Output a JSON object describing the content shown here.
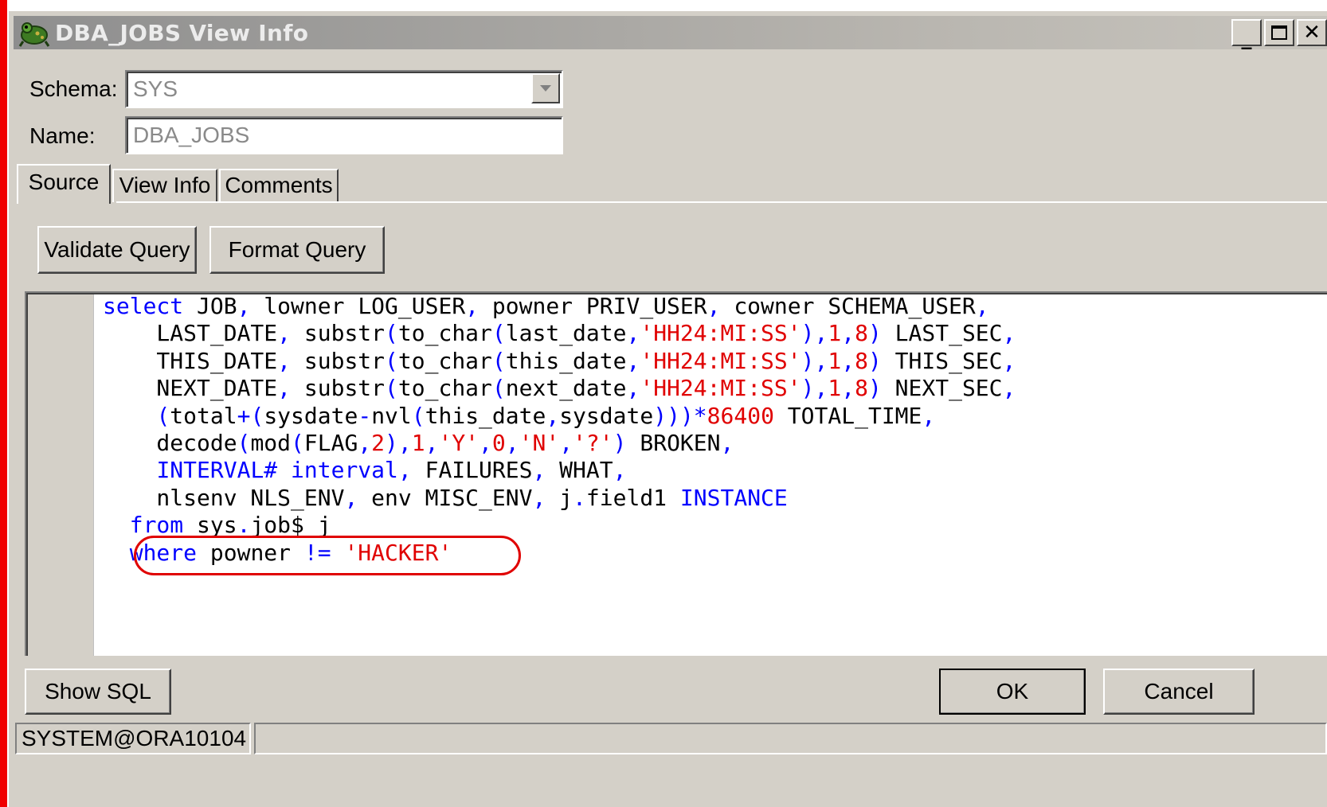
{
  "window": {
    "title": "DBA_JOBS View Info",
    "controls": [
      "minimize",
      "maximize",
      "close"
    ]
  },
  "form": {
    "schema_label": "Schema:",
    "schema_value": "SYS",
    "name_label": "Name:",
    "name_value": "DBA_JOBS"
  },
  "tabs": [
    {
      "label": "Source",
      "active": true
    },
    {
      "label": "View Info",
      "active": false
    },
    {
      "label": "Comments",
      "active": false
    }
  ],
  "toolbar": {
    "validate_label": "Validate Query",
    "format_label": "Format Query"
  },
  "source": {
    "lines": [
      "select JOB, lowner LOG_USER, powner PRIV_USER, cowner SCHEMA_USER,",
      "    LAST_DATE, substr(to_char(last_date,'HH24:MI:SS'),1,8) LAST_SEC,",
      "    THIS_DATE, substr(to_char(this_date,'HH24:MI:SS'),1,8) THIS_SEC,",
      "    NEXT_DATE, substr(to_char(next_date,'HH24:MI:SS'),1,8) NEXT_SEC,",
      "    (total+(sysdate-nvl(this_date,sysdate)))*86400 TOTAL_TIME,",
      "    decode(mod(FLAG,2),1,'Y',0,'N','?') BROKEN,",
      "    INTERVAL# interval, FAILURES, WHAT,",
      "    nlsenv NLS_ENV, env MISC_ENV, j.field1 INSTANCE",
      "  from sys.job$ j",
      "  where powner != 'HACKER'"
    ],
    "highlighted_line": 9,
    "colors": {
      "keyword": "#0000ff",
      "string": "#e00000",
      "annotation": "#e00000"
    }
  },
  "footer": {
    "show_sql_label": "Show SQL",
    "ok_label": "OK",
    "cancel_label": "Cancel"
  },
  "status": {
    "connection": "SYSTEM@ORA10104"
  }
}
